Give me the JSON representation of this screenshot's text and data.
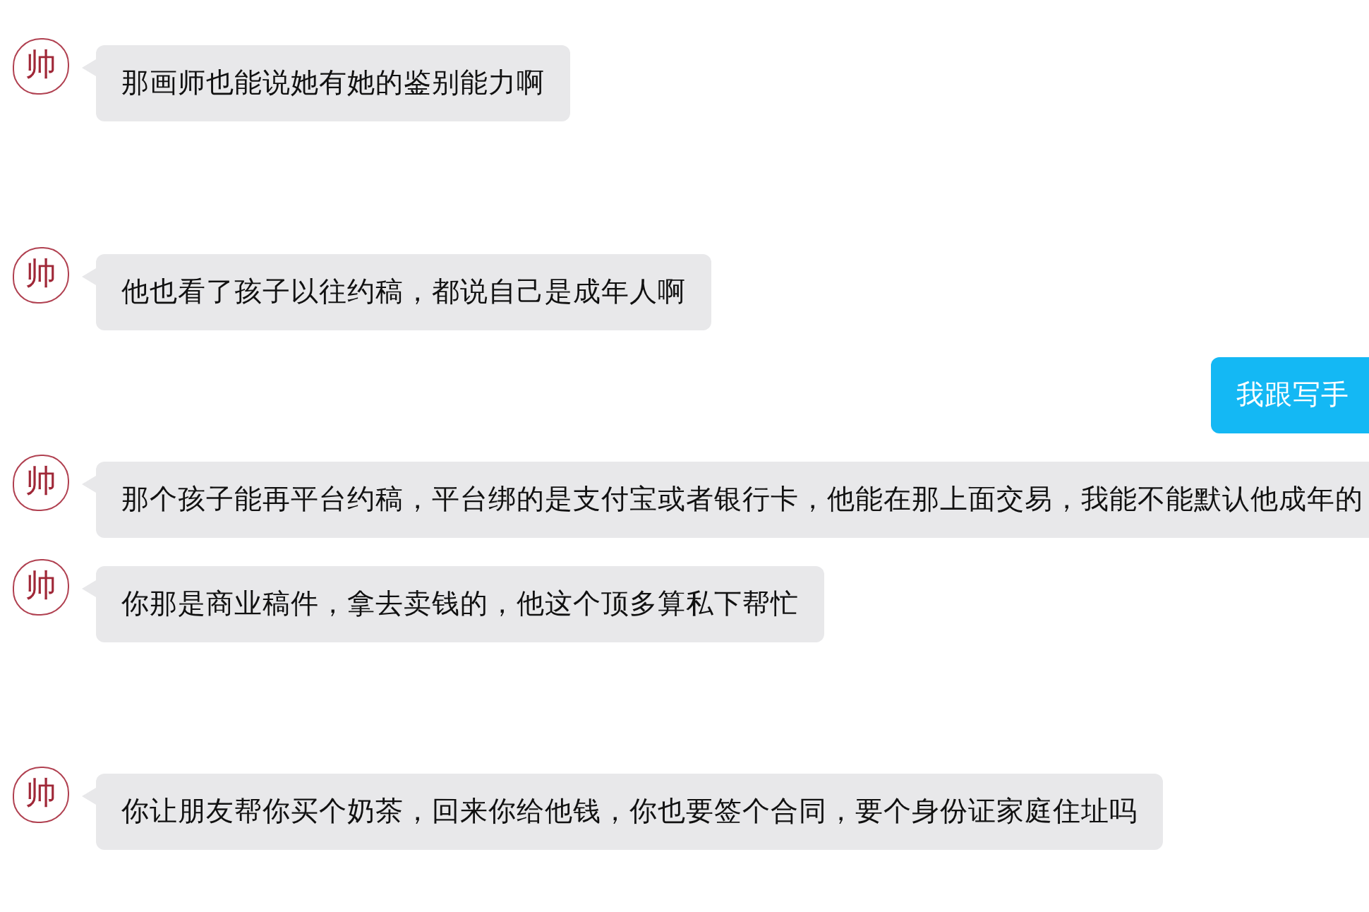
{
  "messages": [
    {
      "kind": "incoming",
      "avatar": "帅",
      "text": "那画师也能说她有她的鉴别能力啊"
    },
    {
      "kind": "incoming",
      "avatar": "帅",
      "text": "他也看了孩子以往约稿，都说自己是成年人啊"
    },
    {
      "kind": "outgoing",
      "text": "我跟写手"
    },
    {
      "kind": "incoming",
      "avatar": "帅",
      "text": "那个孩子能再平台约稿，平台绑的是支付宝或者银行卡，他能在那上面交易，我能不能默认他成年的"
    },
    {
      "kind": "incoming",
      "avatar": "帅",
      "text": "你那是商业稿件，拿去卖钱的，他这个顶多算私下帮忙"
    },
    {
      "kind": "incoming",
      "avatar": "帅",
      "text": "你让朋友帮你买个奶茶，回来你给他钱，你也要签个合同，要个身份证家庭住址吗"
    }
  ]
}
